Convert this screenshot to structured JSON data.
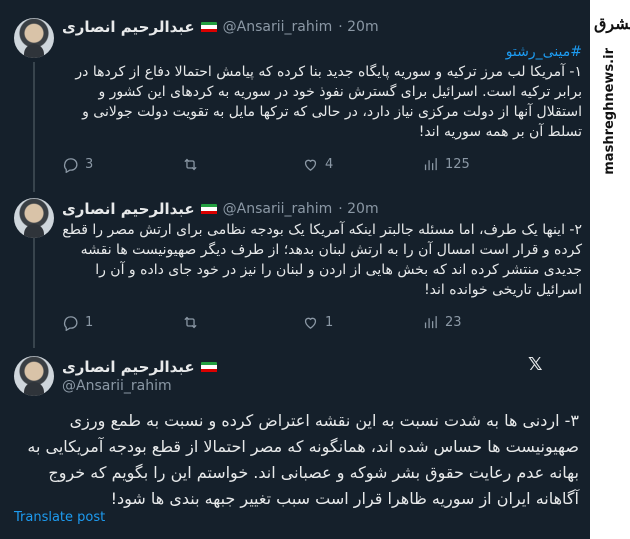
{
  "colors": {
    "background": "#15202b",
    "accent": "#1d9bf0",
    "muted": "#8b98a5"
  },
  "watermark": {
    "logo_text": "مشرق",
    "site": "mashreghnews.ir"
  },
  "tweets": [
    {
      "name": "عبدالرحیم انصاری",
      "handle": "@Ansarii_rahim",
      "time": "· 20m",
      "hashtag": "#مینی_رشتو",
      "text": "۱- آمریکا لب مرز ترکیه و سوریه پایگاه جدید بنا کرده که پیامش احتمالا دفاع از کردها در برابر ترکیه است. اسرائیل برای گسترش نفوذ خود در سوریه به کردهای این کشور و استقلال آنها از دولت مرکزی نیاز دارد، در حالی که ترکها مایل به تقویت دولت جولانی و تسلط آن بر همه سوریه اند!",
      "replies": "3",
      "retweets": "",
      "likes": "4",
      "views": "125"
    },
    {
      "name": "عبدالرحیم انصاری",
      "handle": "@Ansarii_rahim",
      "time": "· 20m",
      "text": "۲- اینها یک طرف، اما مسئله جالبتر اینکه آمریکا یک بودجه نظامی برای ارتش مصر را قطع کرده و قرار است امسال آن را به ارتش لبنان بدهد؛ از طرف دیگر صهیونیست ها نقشه جدیدی منتشر کرده اند که بخش هایی از اردن و لبنان را نیز در خود جای داده و آن را اسرائیل تاریخی خوانده اند!",
      "replies": "1",
      "retweets": "",
      "likes": "1",
      "views": "23"
    },
    {
      "name": "عبدالرحیم انصاری",
      "handle": "@Ansarii_rahim",
      "text": "۳- اردنی ها به شدت نسبت به این نقشه اعتراض کرده و نسبت به طمع ورزی صهیونیست ها حساس شده اند، همانگونه که مصر احتمالا از قطع بودجه آمریکایی به بهانه عدم رعایت حقوق بشر شوکه و عصبانی اند. خواستم این را بگویم که خروج آگاهانه ایران از سوریه ظاهرا قرار است سبب تغییر جبهه بندی ها شود!",
      "translate": "Translate post"
    }
  ]
}
